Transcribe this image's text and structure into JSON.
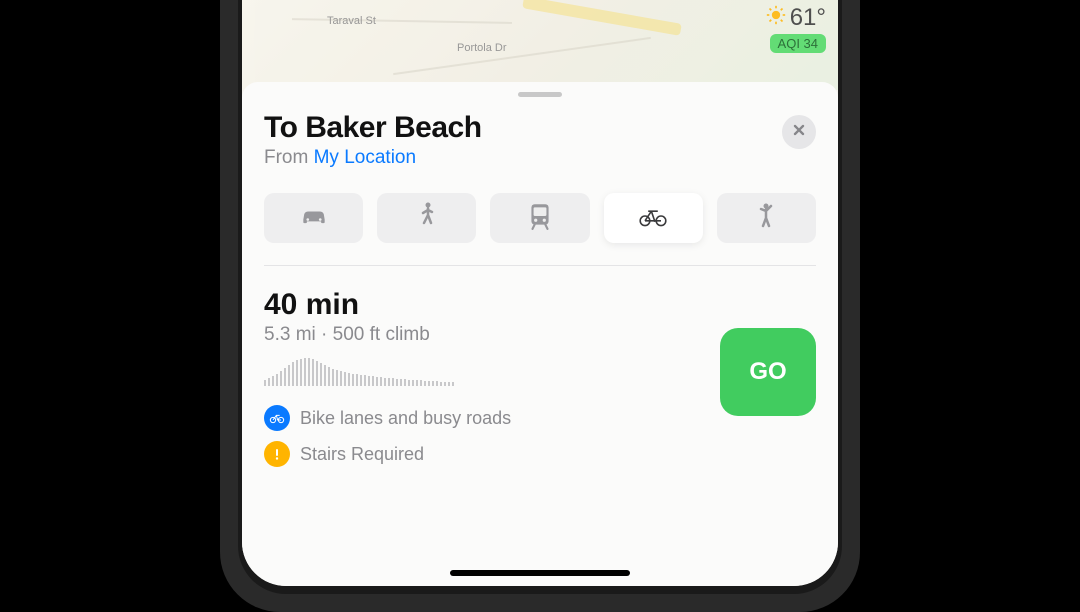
{
  "map": {
    "streets": [
      "Taraval St",
      "Portola Dr"
    ]
  },
  "weather": {
    "temp": "61°",
    "aqi": "AQI 34"
  },
  "destination": {
    "title": "To Baker Beach",
    "from_label": "From ",
    "from_location": "My Location"
  },
  "modes": [
    "car",
    "walk",
    "transit",
    "bike",
    "rideshare"
  ],
  "selected_mode": "bike",
  "route": {
    "time": "40 min",
    "distance": "5.3 mi",
    "climb": "500 ft climb",
    "separator": " · ",
    "go_label": "GO",
    "infos": [
      {
        "icon": "bike",
        "color": "blue",
        "text": "Bike lanes and busy roads"
      },
      {
        "icon": "warning",
        "color": "orange",
        "text": "Stairs Required"
      }
    ]
  }
}
